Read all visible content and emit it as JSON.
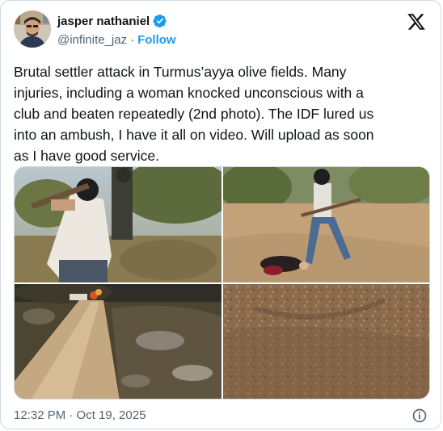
{
  "author": {
    "display_name": "jasper nathaniel",
    "handle": "@infinite_jaz",
    "follow_label": "Follow",
    "verified": true
  },
  "tweet": {
    "text": "Brutal settler attack in Turmus’ayya olive fields. Many\ninjuries, including a woman knocked unconscious with a\nclub and beaten repeatedly (2nd photo). The IDF lured us\ninto an ambush, I have it all on video. Will upload as soon\nas I have good service."
  },
  "footer": {
    "timestamp": "12:32 PM · Oct 19, 2025"
  },
  "colors": {
    "accent": "#1d9bf0",
    "text_primary": "#0f1419",
    "text_secondary": "#536471",
    "border": "#cfd9de"
  },
  "icons": [
    "verified-badge-icon",
    "x-logo-icon",
    "info-icon"
  ]
}
